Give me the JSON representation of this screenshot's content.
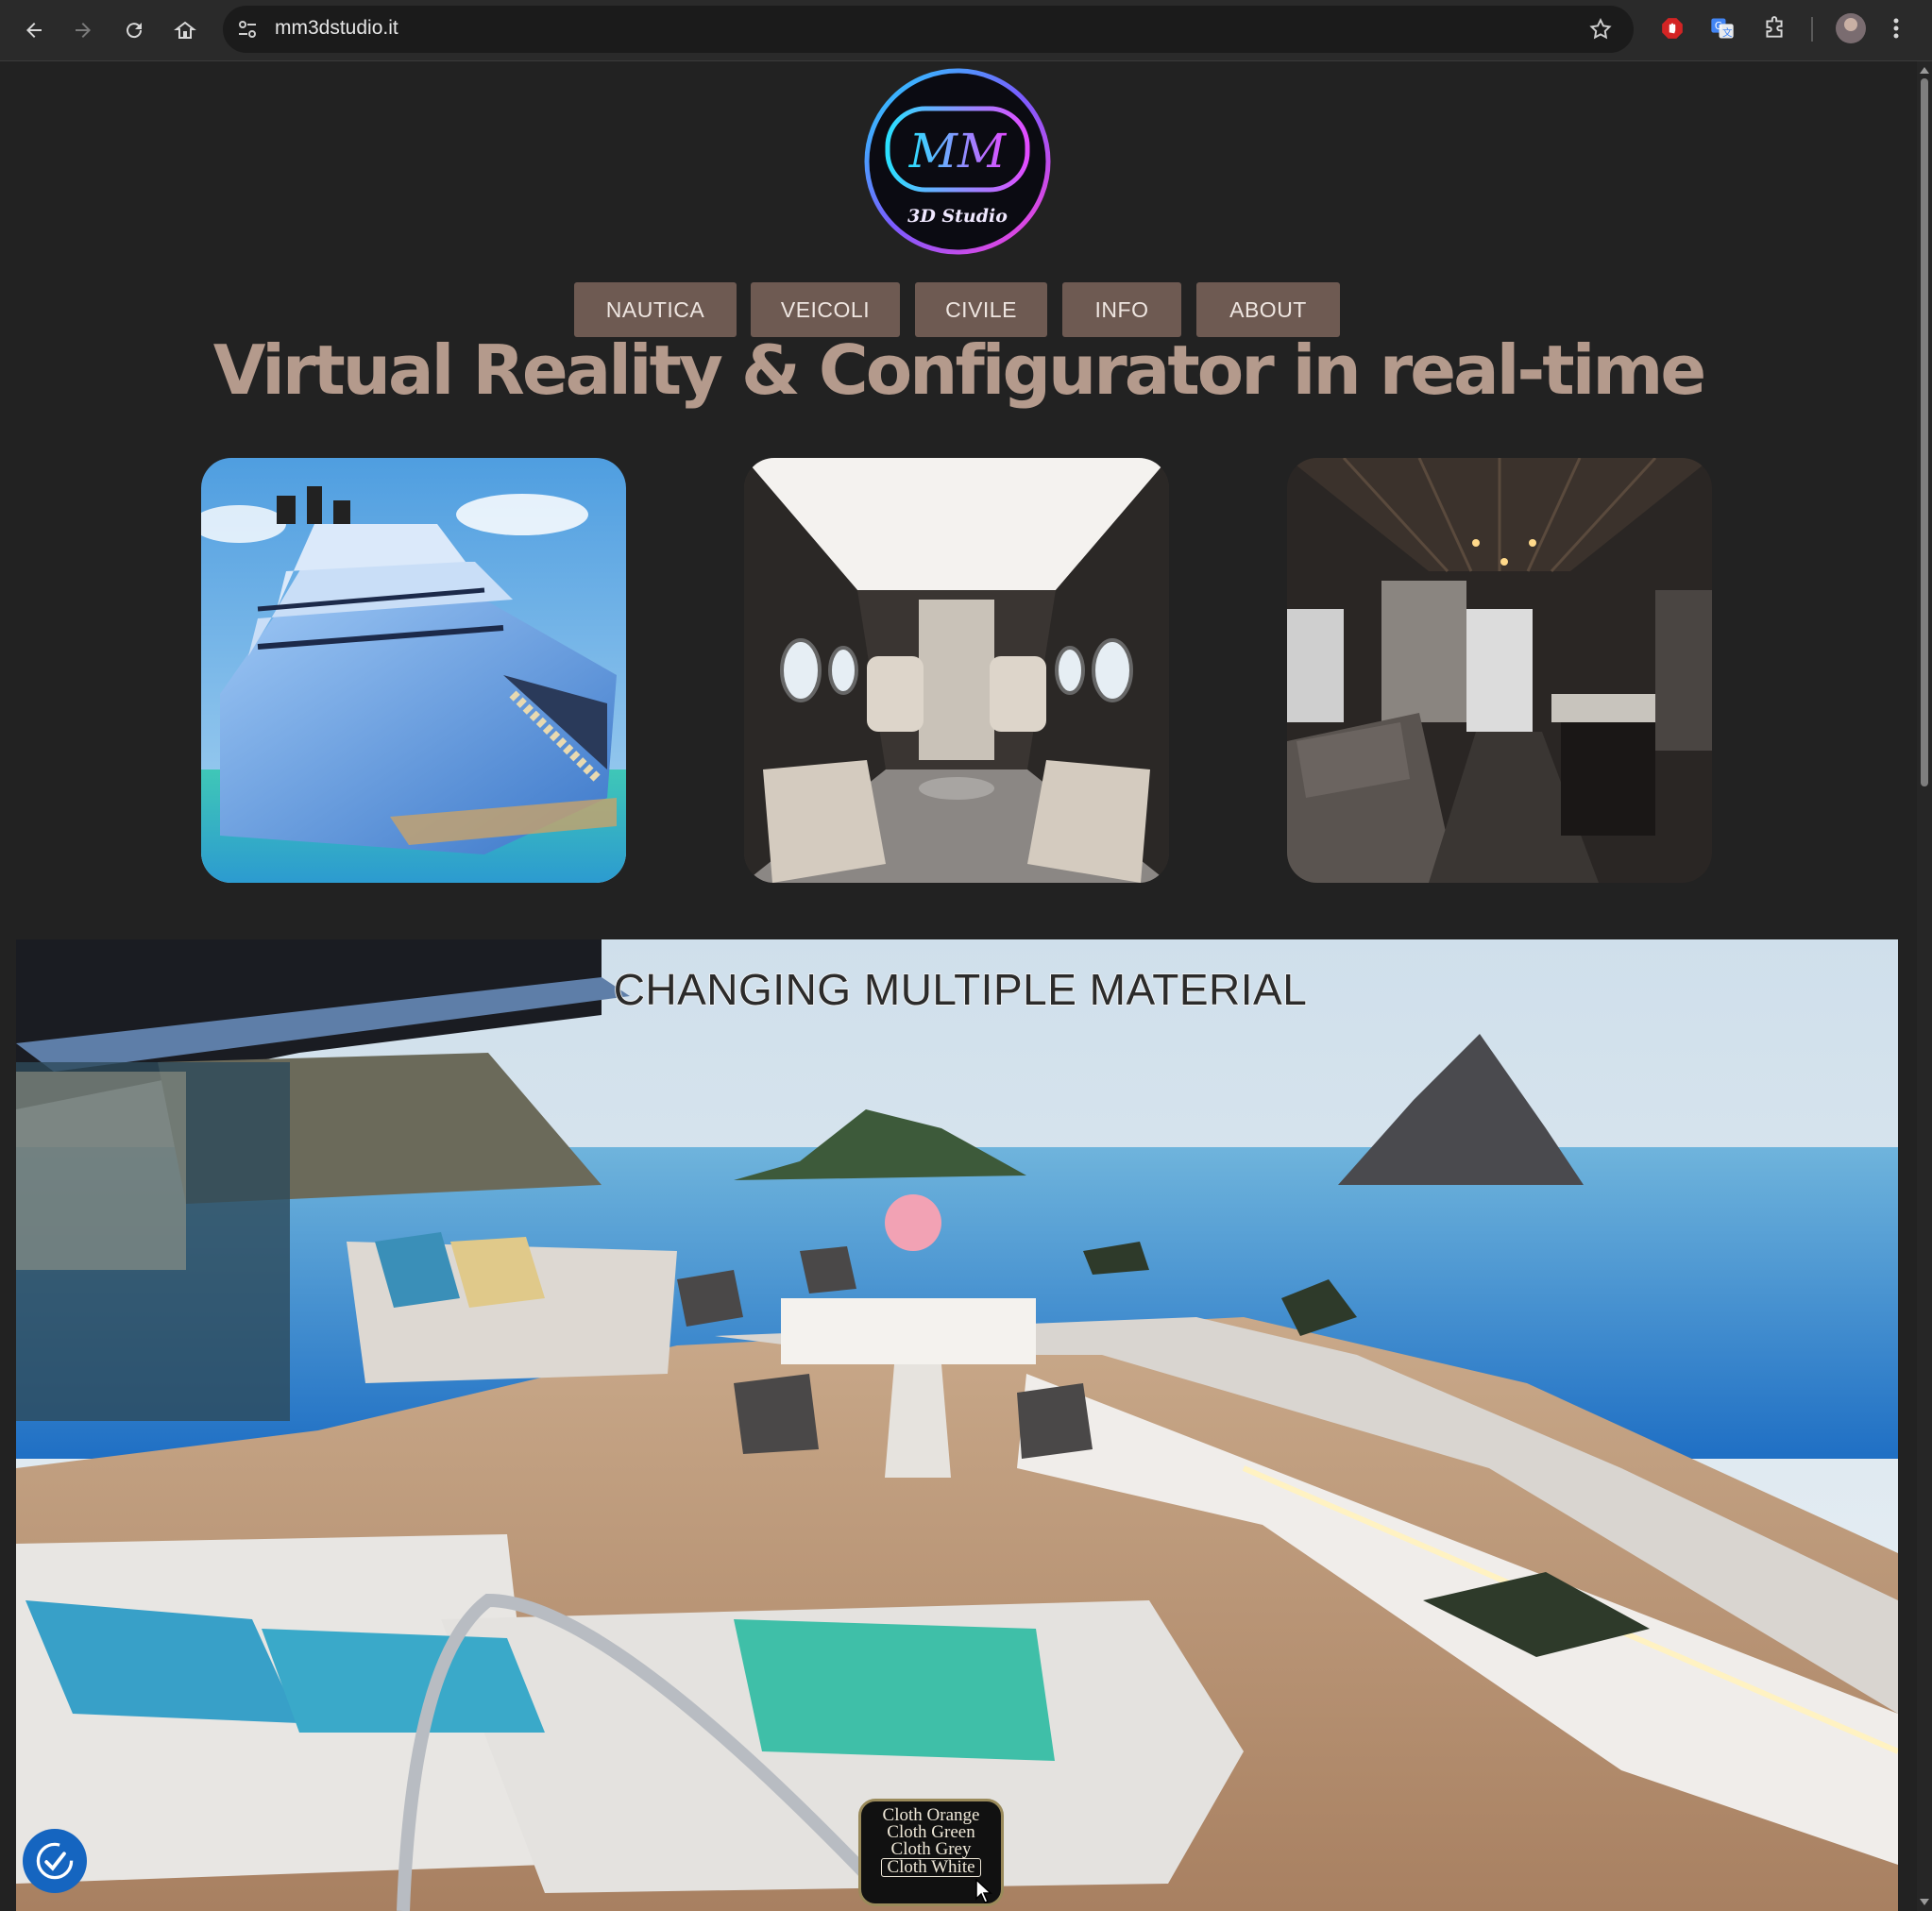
{
  "browser": {
    "url": "mm3dstudio.it"
  },
  "logo": {
    "monogram": "MM",
    "tagline": "3D Studio"
  },
  "nav": {
    "items": [
      {
        "label": "NAUTICA"
      },
      {
        "label": "VEICOLI"
      },
      {
        "label": "CIVILE"
      },
      {
        "label": "INFO"
      },
      {
        "label": "ABOUT"
      }
    ]
  },
  "headline": "Virtual Reality & Configurator in real-time",
  "showcase": {
    "title": "CHANGING MULTIPLE MATERIAL",
    "materials": [
      {
        "label": "Cloth Orange"
      },
      {
        "label": "Cloth Green"
      },
      {
        "label": "Cloth Grey"
      },
      {
        "label": "Cloth White"
      }
    ],
    "selected": "Cloth White"
  },
  "colors": {
    "page_bg": "#222222",
    "nav_button": "#6e5a52",
    "headline": "#b49a8c",
    "accessibility": "#1565c0"
  }
}
